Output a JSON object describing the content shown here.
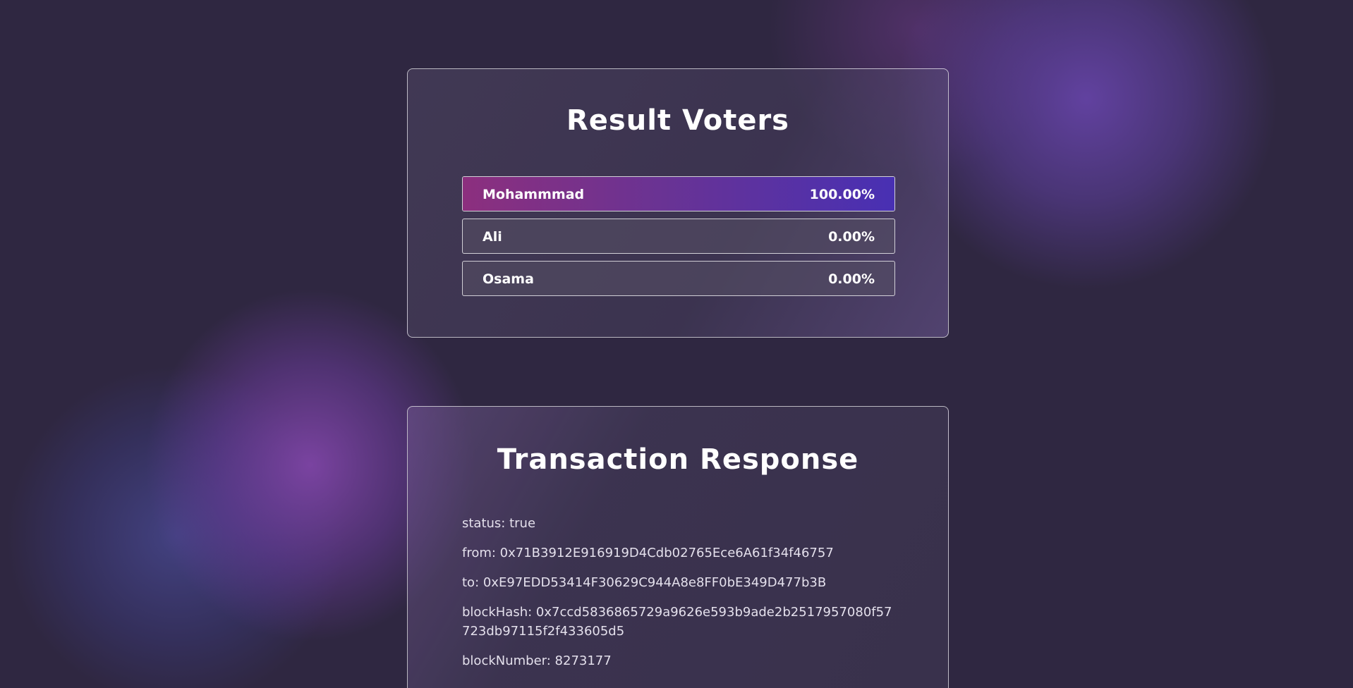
{
  "results": {
    "title": "Result Voters",
    "voters": [
      {
        "name": "Mohammmad",
        "percent": "100.00%",
        "share": 1.0
      },
      {
        "name": "Ali",
        "percent": "0.00%",
        "share": 0.0
      },
      {
        "name": "Osama",
        "percent": "0.00%",
        "share": 0.0
      }
    ]
  },
  "transaction": {
    "title": "Transaction Response",
    "fields": {
      "status": "status: true",
      "from": "from: 0x71B3912E916919D4Cdb02765Ece6A61f34f46757",
      "to": "to: 0xE97EDD53414F30629C944A8e8FF0bE349D477b3B",
      "block_hash": "blockHash: 0x7ccd5836865729a9626e593b9ade2b2517957080f57723db97115f2f433605d5",
      "block_number": "blockNumber: 8273177"
    }
  },
  "colors": {
    "background": "#2f2741",
    "bar_start": "#8c2f7e",
    "bar_end": "#4830b3"
  }
}
